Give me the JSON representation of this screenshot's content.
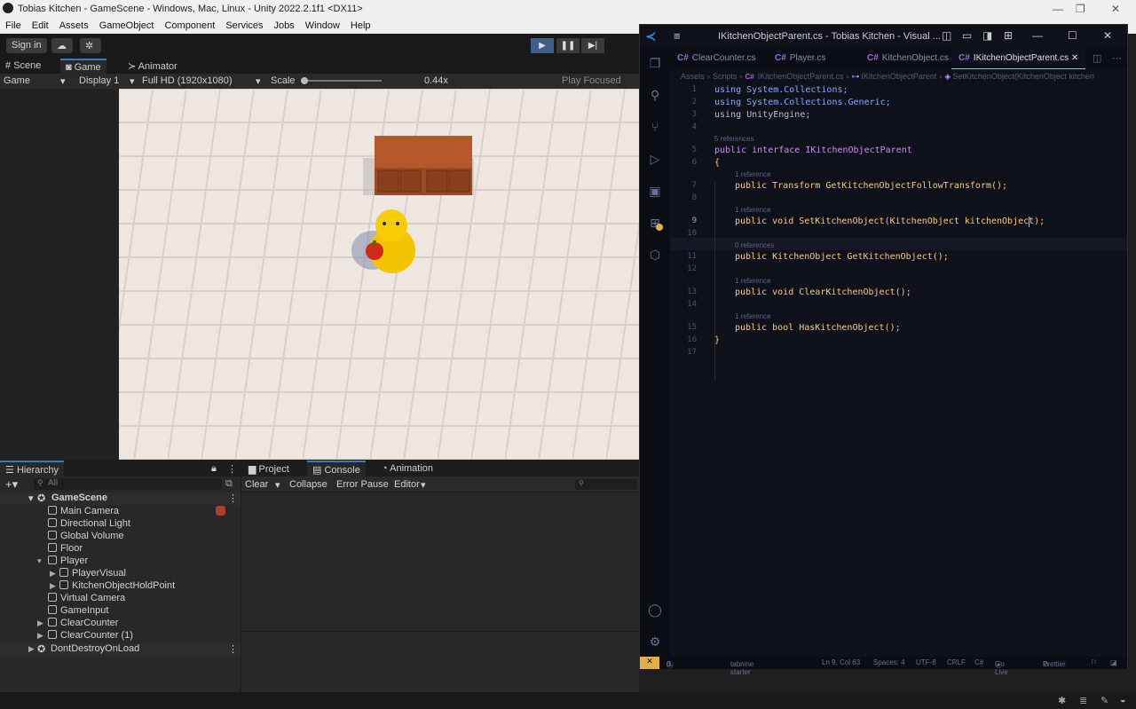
{
  "unity": {
    "window_title": "Tobias Kitchen - GameScene - Windows, Mac, Linux - Unity 2022.2.1f1 <DX11>",
    "menu": [
      "File",
      "Edit",
      "Assets",
      "GameObject",
      "Component",
      "Services",
      "Jobs",
      "Window",
      "Help"
    ],
    "toolbar": {
      "sign_in": "Sign in"
    },
    "view_tabs": [
      "Scene",
      "Game",
      "Animator"
    ],
    "gamebar": {
      "mode": "Game",
      "display": "Display 1",
      "resolution": "Full HD (1920x1080)",
      "scale_label": "Scale",
      "scale_value": "0.44x",
      "play_focused": "Play Focused"
    },
    "hierarchy": {
      "tab": "Hierarchy",
      "search_placeholder": "All",
      "scene": "GameScene",
      "items": [
        {
          "label": "Main Camera",
          "depth": 1
        },
        {
          "label": "Directional Light",
          "depth": 1
        },
        {
          "label": "Global Volume",
          "depth": 1
        },
        {
          "label": "Floor",
          "depth": 1
        },
        {
          "label": "Player",
          "depth": 1
        },
        {
          "label": "PlayerVisual",
          "depth": 2
        },
        {
          "label": "KitchenObjectHoldPoint",
          "depth": 2
        },
        {
          "label": "Virtual Camera",
          "depth": 1
        },
        {
          "label": "GameInput",
          "depth": 1
        },
        {
          "label": "ClearCounter",
          "depth": 1
        },
        {
          "label": "ClearCounter (1)",
          "depth": 1
        }
      ],
      "dont_destroy": "DontDestroyOnLoad"
    },
    "bottom_tabs": [
      "Project",
      "Console",
      "Animation"
    ],
    "console_toolbar": [
      "Clear",
      "Collapse",
      "Error Pause",
      "Editor"
    ]
  },
  "vscode": {
    "title": "IKitchenObjectParent.cs - Tobias Kitchen - Visual ...",
    "tabs": [
      "ClearCounter.cs",
      "Player.cs",
      "KitchenObject.cs",
      "IKitchenObjectParent.cs"
    ],
    "breadcrumb": [
      "Assets",
      "Scripts",
      "IKitchenObjectParent.cs",
      "IKitchenObjectParent",
      "SetKitchenObject(KitchenObject kitchen"
    ],
    "line_numbers": [
      "1",
      "2",
      "3",
      "4",
      "5",
      "6",
      "7",
      "8",
      "9",
      "10",
      "11",
      "12",
      "13",
      "14",
      "15",
      "16",
      "17"
    ],
    "refs": {
      "r5": "5 references",
      "r1a": "1 reference",
      "r1b": "1 reference",
      "r0": "0 references",
      "r1c": "1 reference",
      "r1d": "1 reference"
    },
    "code": {
      "l1": "using System.Collections;",
      "l2": "using System.Collections.Generic;",
      "l3": "using UnityEngine;",
      "l5": "public interface IKitchenObjectParent",
      "l6": "{",
      "l7": "public Transform GetKitchenObjectFollowTransform();",
      "l9": "public void SetKitchenObject(KitchenObject kitchenObject);",
      "l11": "public KitchenObject GetKitchenObject();",
      "l13": "public void ClearKitchenObject();",
      "l15": "public bool HasKitchenObject();",
      "l16": "}"
    },
    "status": {
      "errors": "0",
      "warnings": "0",
      "tabnine": "tabnine starter",
      "position": "Ln 9, Col 63",
      "spaces": "Spaces: 4",
      "encoding": "UTF-8",
      "eol": "CRLF",
      "lang": "C#",
      "golive": "Go Live",
      "prettier": "Prettier"
    }
  }
}
